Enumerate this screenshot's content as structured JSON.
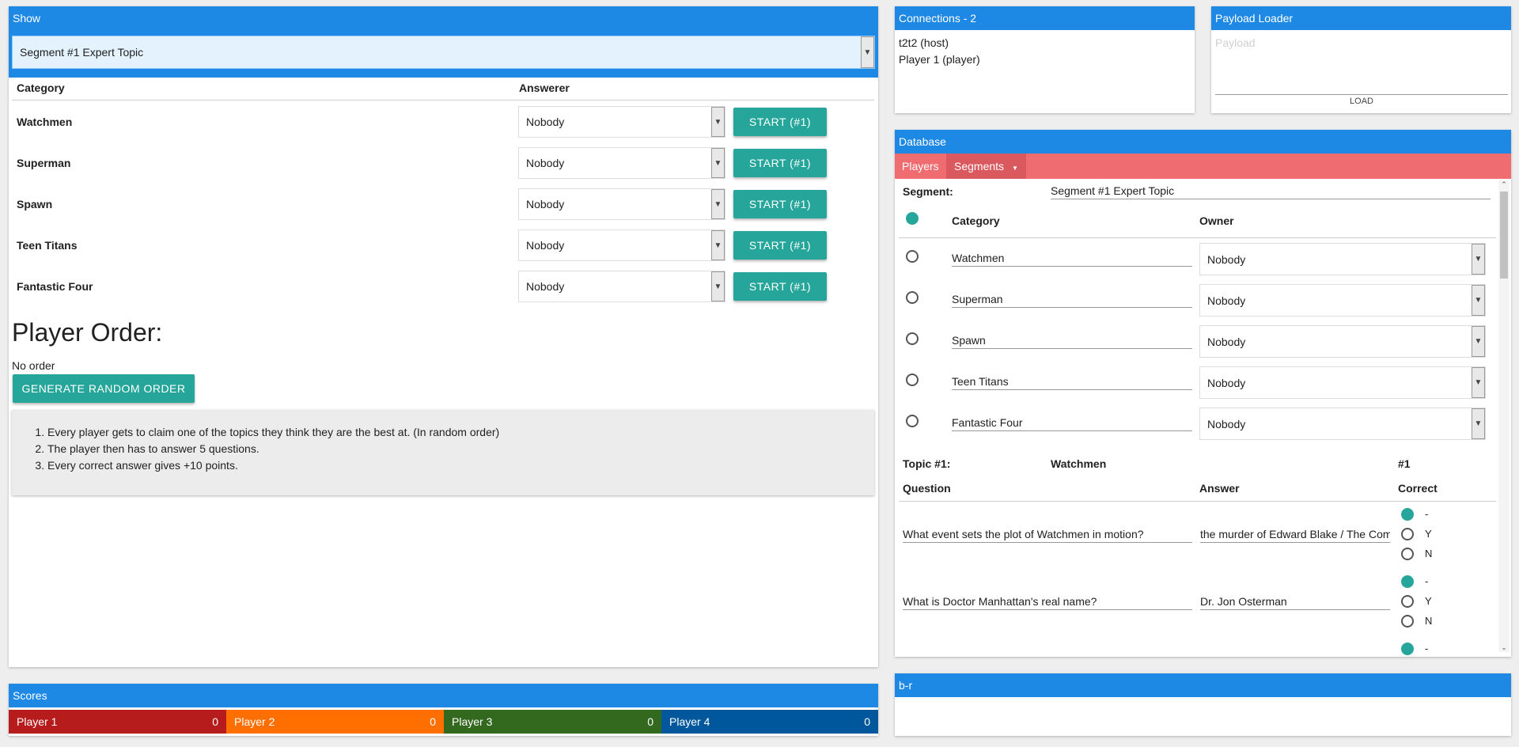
{
  "show": {
    "title": "Show",
    "segment_select": "Segment #1 Expert Topic",
    "col_category": "Category",
    "col_answerer": "Answerer",
    "rows": [
      {
        "category": "Watchmen",
        "answerer": "Nobody",
        "button": "START (#1)"
      },
      {
        "category": "Superman",
        "answerer": "Nobody",
        "button": "START (#1)"
      },
      {
        "category": "Spawn",
        "answerer": "Nobody",
        "button": "START (#1)"
      },
      {
        "category": "Teen Titans",
        "answerer": "Nobody",
        "button": "START (#1)"
      },
      {
        "category": "Fantastic Four",
        "answerer": "Nobody",
        "button": "START (#1)"
      }
    ],
    "player_order_heading": "Player Order:",
    "order_text": "No order",
    "generate_button": "GENERATE RANDOM ORDER",
    "rules": [
      "Every player gets to claim one of the topics they think they are the best at. (In random order)",
      "The player then has to answer 5 questions.",
      "Every correct answer gives +10 points."
    ]
  },
  "scores": {
    "title": "Scores",
    "players": [
      {
        "name": "Player 1",
        "score": "0",
        "color": "#b71c1c"
      },
      {
        "name": "Player 2",
        "score": "0",
        "color": "#ff6f00"
      },
      {
        "name": "Player 3",
        "score": "0",
        "color": "#33691e"
      },
      {
        "name": "Player 4",
        "score": "0",
        "color": "#01579b"
      }
    ]
  },
  "connections": {
    "title": "Connections - 2",
    "items": [
      "t2t2 (host)",
      "Player 1 (player)"
    ]
  },
  "payload_loader": {
    "title": "Payload Loader",
    "placeholder": "Payload",
    "load_button": "LOAD"
  },
  "database": {
    "title": "Database",
    "tabs": [
      "Players",
      "Segments"
    ],
    "segment_label": "Segment:",
    "segment_value": "Segment #1 Expert Topic",
    "col_category": "Category",
    "col_owner": "Owner",
    "rows": [
      {
        "category": "Watchmen",
        "owner": "Nobody"
      },
      {
        "category": "Superman",
        "owner": "Nobody"
      },
      {
        "category": "Spawn",
        "owner": "Nobody"
      },
      {
        "category": "Teen Titans",
        "owner": "Nobody"
      },
      {
        "category": "Fantastic Four",
        "owner": "Nobody"
      }
    ],
    "topic_label": "Topic #1:",
    "topic_value": "Watchmen",
    "topic_number": "#1",
    "col_question": "Question",
    "col_answer": "Answer",
    "col_correct": "Correct",
    "questions": [
      {
        "question": "What event sets the plot of Watchmen in motion?",
        "answer": "the murder of Edward Blake / The Com"
      },
      {
        "question": "What is Doctor Manhattan's real name?",
        "answer": "Dr. Jon Osterman"
      }
    ],
    "correct_options": [
      "-",
      "Y",
      "N"
    ],
    "third_option": "-"
  },
  "br": {
    "title": "b-r"
  }
}
